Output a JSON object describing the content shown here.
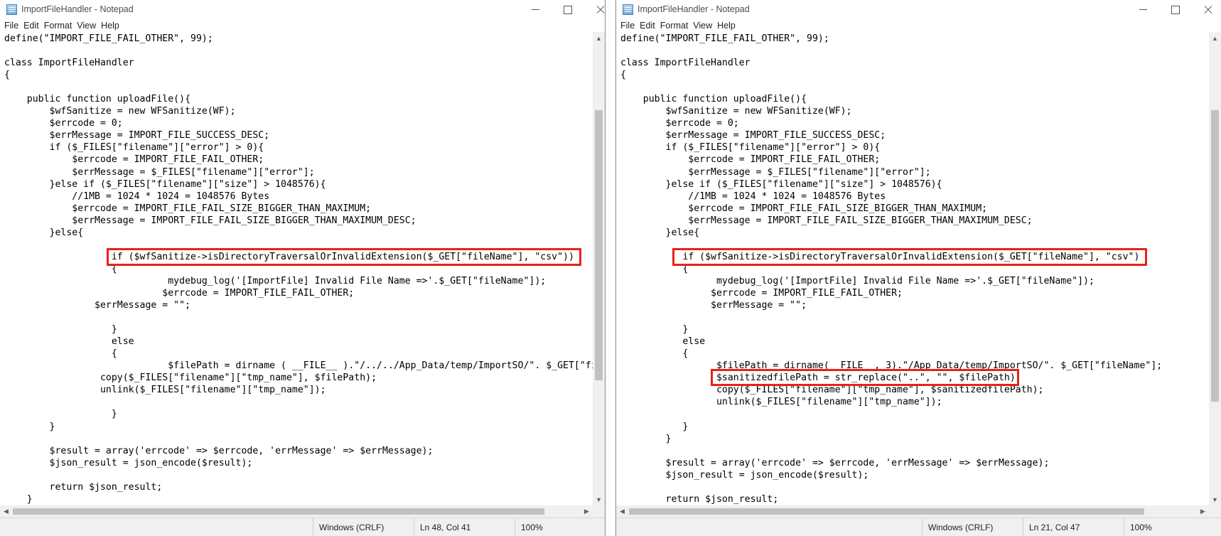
{
  "windows": [
    {
      "title": "ImportFileHandler - Notepad",
      "menu": [
        "File",
        "Edit",
        "Format",
        "View",
        "Help"
      ],
      "code": [
        "define(\"IMPORT_FILE_FAIL_OTHER\", 99);",
        "",
        "class ImportFileHandler",
        "{",
        "",
        "    public function uploadFile(){",
        "        $wfSanitize = new WFSanitize(WF);",
        "        $errcode = 0;",
        "        $errMessage = IMPORT_FILE_SUCCESS_DESC;",
        "        if ($_FILES[\"filename\"][\"error\"] > 0){",
        "            $errcode = IMPORT_FILE_FAIL_OTHER;",
        "            $errMessage = $_FILES[\"filename\"][\"error\"];",
        "        }else if ($_FILES[\"filename\"][\"size\"] > 1048576){",
        "            //1MB = 1024 * 1024 = 1048576 Bytes",
        "            $errcode = IMPORT_FILE_FAIL_SIZE_BIGGER_THAN_MAXIMUM;",
        "            $errMessage = IMPORT_FILE_FAIL_SIZE_BIGGER_THAN_MAXIMUM_DESC;",
        "        }else{",
        "",
        "                   if ($wfSanitize->isDirectoryTraversalOrInvalidExtension($_GET[\"fileName\"], \"csv\"))",
        "                   {",
        "                             mydebug_log('[ImportFile] Invalid File Name =>'.$_GET[\"fileName\"]);",
        "                            $errcode = IMPORT_FILE_FAIL_OTHER;",
        "                $errMessage = \"\";",
        "",
        "                   }",
        "                   else",
        "                   {",
        "                             $filePath = dirname ( __FILE__ ).\"/../../App_Data/temp/ImportSO/\". $_GET[\"fileName\"];",
        "                 copy($_FILES[\"filename\"][\"tmp_name\"], $filePath);",
        "                 unlink($_FILES[\"filename\"][\"tmp_name\"]);",
        "",
        "                   }",
        "        }",
        "",
        "        $result = array('errcode' => $errcode, 'errMessage' => $errMessage);",
        "        $json_result = json_encode($result);",
        "",
        "        return $json_result;",
        "    }"
      ],
      "status": {
        "encoding": "Windows (CRLF)",
        "position": "Ln 48, Col 41",
        "zoom": "100%"
      }
    },
    {
      "title": "ImportFileHandler - Notepad",
      "menu": [
        "File",
        "Edit",
        "Format",
        "View",
        "Help"
      ],
      "code": [
        "define(\"IMPORT_FILE_FAIL_OTHER\", 99);",
        "",
        "class ImportFileHandler",
        "{",
        "",
        "    public function uploadFile(){",
        "        $wfSanitize = new WFSanitize(WF);",
        "        $errcode = 0;",
        "        $errMessage = IMPORT_FILE_SUCCESS_DESC;",
        "        if ($_FILES[\"filename\"][\"error\"] > 0){",
        "            $errcode = IMPORT_FILE_FAIL_OTHER;",
        "            $errMessage = $_FILES[\"filename\"][\"error\"];",
        "        }else if ($_FILES[\"filename\"][\"size\"] > 1048576){",
        "            //1MB = 1024 * 1024 = 1048576 Bytes",
        "            $errcode = IMPORT_FILE_FAIL_SIZE_BIGGER_THAN_MAXIMUM;",
        "            $errMessage = IMPORT_FILE_FAIL_SIZE_BIGGER_THAN_MAXIMUM_DESC;",
        "        }else{",
        "",
        "           if ($wfSanitize->isDirectoryTraversalOrInvalidExtension($_GET[\"fileName\"], \"csv\")",
        "           {",
        "                 mydebug_log('[ImportFile] Invalid File Name =>'.$_GET[\"fileName\"]);",
        "                $errcode = IMPORT_FILE_FAIL_OTHER;",
        "                $errMessage = \"\";",
        "",
        "           }",
        "           else",
        "           {",
        "                 $filePath = dirname(__FILE__, 3).\"/App_Data/temp/ImportSO/\". $_GET[\"fileName\"];",
        "                 $sanitizedfilePath = str_replace(\"..\", \"\", $filePath);",
        "                 copy($_FILES[\"filename\"][\"tmp_name\"], $sanitizedfilePath);",
        "                 unlink($_FILES[\"filename\"][\"tmp_name\"]);",
        "",
        "           }",
        "        }",
        "",
        "        $result = array('errcode' => $errcode, 'errMessage' => $errMessage);",
        "        $json_result = json_encode($result);",
        "",
        "        return $json_result;",
        "    }"
      ],
      "status": {
        "encoding": "Windows (CRLF)",
        "position": "Ln 21, Col 47",
        "zoom": "100%"
      }
    }
  ]
}
